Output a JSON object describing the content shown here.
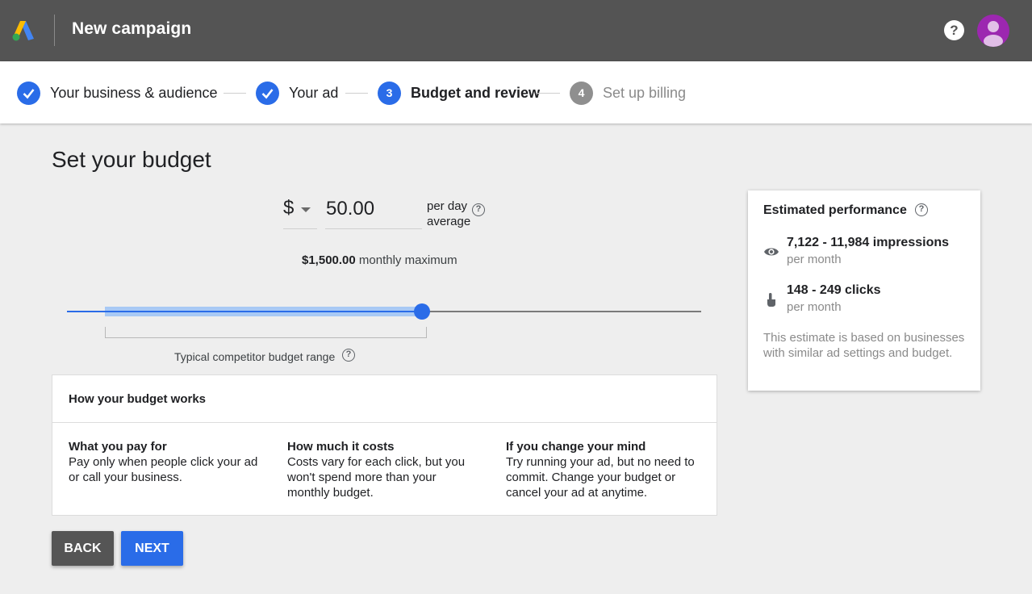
{
  "header": {
    "title": "New campaign",
    "help_label": "?",
    "logo_icon": "google-ads-logo",
    "avatar_icon": "account-avatar"
  },
  "stepper": {
    "steps": [
      {
        "label": "Your business & audience",
        "state": "done",
        "number": ""
      },
      {
        "label": "Your ad",
        "state": "done",
        "number": ""
      },
      {
        "label": "Budget and review",
        "state": "active",
        "number": "3"
      },
      {
        "label": "Set up billing",
        "state": "todo",
        "number": "4"
      }
    ]
  },
  "budget": {
    "page_title": "Set your budget",
    "currency_symbol": "$",
    "amount": "50.00",
    "per_day_line1": "per day",
    "per_day_line2": "average",
    "monthly_max_value": "$1,500.00",
    "monthly_max_label": " monthly maximum",
    "slider_level": 0.56,
    "competitor_range": [
      0.06,
      0.57
    ],
    "competitor_range_label": "Typical competitor budget range",
    "help_icon_text": "?"
  },
  "how_it_works": {
    "title": "How your budget works",
    "columns": [
      {
        "heading": "What you pay for",
        "text": "Pay only when people click your ad or call your business."
      },
      {
        "heading": "How much it costs",
        "text": "Costs vary for each click, but you won't spend more than your monthly budget."
      },
      {
        "heading": "If you change your mind",
        "text": "Try running your ad, but no need to commit. Change your budget or cancel your ad at anytime."
      }
    ]
  },
  "actions": {
    "back_label": "BACK",
    "next_label": "NEXT"
  },
  "performance": {
    "title": "Estimated performance",
    "impressions": "7,122 - 11,984 impressions",
    "impressions_period": "per month",
    "clicks": "148 - 249 clicks",
    "clicks_period": "per month",
    "note": "This estimate is based on businesses with similar ad settings and budget.",
    "impressions_icon": "eye-icon",
    "clicks_icon": "click-hand-icon"
  },
  "colors": {
    "accent": "#2a6ce8",
    "topbar": "#545454",
    "avatar": "#9c27b0",
    "range_fill": "#a8c9f5"
  }
}
